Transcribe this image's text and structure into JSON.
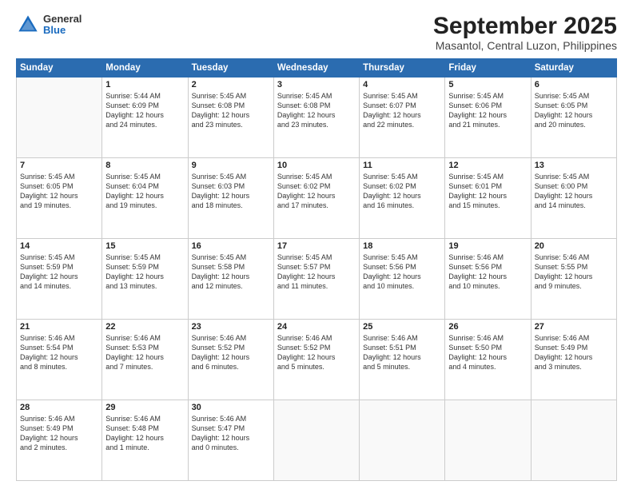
{
  "logo": {
    "general": "General",
    "blue": "Blue"
  },
  "title": "September 2025",
  "subtitle": "Masantol, Central Luzon, Philippines",
  "days_header": [
    "Sunday",
    "Monday",
    "Tuesday",
    "Wednesday",
    "Thursday",
    "Friday",
    "Saturday"
  ],
  "weeks": [
    [
      {
        "day": "",
        "info": ""
      },
      {
        "day": "1",
        "info": "Sunrise: 5:44 AM\nSunset: 6:09 PM\nDaylight: 12 hours\nand 24 minutes."
      },
      {
        "day": "2",
        "info": "Sunrise: 5:45 AM\nSunset: 6:08 PM\nDaylight: 12 hours\nand 23 minutes."
      },
      {
        "day": "3",
        "info": "Sunrise: 5:45 AM\nSunset: 6:08 PM\nDaylight: 12 hours\nand 23 minutes."
      },
      {
        "day": "4",
        "info": "Sunrise: 5:45 AM\nSunset: 6:07 PM\nDaylight: 12 hours\nand 22 minutes."
      },
      {
        "day": "5",
        "info": "Sunrise: 5:45 AM\nSunset: 6:06 PM\nDaylight: 12 hours\nand 21 minutes."
      },
      {
        "day": "6",
        "info": "Sunrise: 5:45 AM\nSunset: 6:05 PM\nDaylight: 12 hours\nand 20 minutes."
      }
    ],
    [
      {
        "day": "7",
        "info": "Sunrise: 5:45 AM\nSunset: 6:05 PM\nDaylight: 12 hours\nand 19 minutes."
      },
      {
        "day": "8",
        "info": "Sunrise: 5:45 AM\nSunset: 6:04 PM\nDaylight: 12 hours\nand 19 minutes."
      },
      {
        "day": "9",
        "info": "Sunrise: 5:45 AM\nSunset: 6:03 PM\nDaylight: 12 hours\nand 18 minutes."
      },
      {
        "day": "10",
        "info": "Sunrise: 5:45 AM\nSunset: 6:02 PM\nDaylight: 12 hours\nand 17 minutes."
      },
      {
        "day": "11",
        "info": "Sunrise: 5:45 AM\nSunset: 6:02 PM\nDaylight: 12 hours\nand 16 minutes."
      },
      {
        "day": "12",
        "info": "Sunrise: 5:45 AM\nSunset: 6:01 PM\nDaylight: 12 hours\nand 15 minutes."
      },
      {
        "day": "13",
        "info": "Sunrise: 5:45 AM\nSunset: 6:00 PM\nDaylight: 12 hours\nand 14 minutes."
      }
    ],
    [
      {
        "day": "14",
        "info": "Sunrise: 5:45 AM\nSunset: 5:59 PM\nDaylight: 12 hours\nand 14 minutes."
      },
      {
        "day": "15",
        "info": "Sunrise: 5:45 AM\nSunset: 5:59 PM\nDaylight: 12 hours\nand 13 minutes."
      },
      {
        "day": "16",
        "info": "Sunrise: 5:45 AM\nSunset: 5:58 PM\nDaylight: 12 hours\nand 12 minutes."
      },
      {
        "day": "17",
        "info": "Sunrise: 5:45 AM\nSunset: 5:57 PM\nDaylight: 12 hours\nand 11 minutes."
      },
      {
        "day": "18",
        "info": "Sunrise: 5:45 AM\nSunset: 5:56 PM\nDaylight: 12 hours\nand 10 minutes."
      },
      {
        "day": "19",
        "info": "Sunrise: 5:46 AM\nSunset: 5:56 PM\nDaylight: 12 hours\nand 10 minutes."
      },
      {
        "day": "20",
        "info": "Sunrise: 5:46 AM\nSunset: 5:55 PM\nDaylight: 12 hours\nand 9 minutes."
      }
    ],
    [
      {
        "day": "21",
        "info": "Sunrise: 5:46 AM\nSunset: 5:54 PM\nDaylight: 12 hours\nand 8 minutes."
      },
      {
        "day": "22",
        "info": "Sunrise: 5:46 AM\nSunset: 5:53 PM\nDaylight: 12 hours\nand 7 minutes."
      },
      {
        "day": "23",
        "info": "Sunrise: 5:46 AM\nSunset: 5:52 PM\nDaylight: 12 hours\nand 6 minutes."
      },
      {
        "day": "24",
        "info": "Sunrise: 5:46 AM\nSunset: 5:52 PM\nDaylight: 12 hours\nand 5 minutes."
      },
      {
        "day": "25",
        "info": "Sunrise: 5:46 AM\nSunset: 5:51 PM\nDaylight: 12 hours\nand 5 minutes."
      },
      {
        "day": "26",
        "info": "Sunrise: 5:46 AM\nSunset: 5:50 PM\nDaylight: 12 hours\nand 4 minutes."
      },
      {
        "day": "27",
        "info": "Sunrise: 5:46 AM\nSunset: 5:49 PM\nDaylight: 12 hours\nand 3 minutes."
      }
    ],
    [
      {
        "day": "28",
        "info": "Sunrise: 5:46 AM\nSunset: 5:49 PM\nDaylight: 12 hours\nand 2 minutes."
      },
      {
        "day": "29",
        "info": "Sunrise: 5:46 AM\nSunset: 5:48 PM\nDaylight: 12 hours\nand 1 minute."
      },
      {
        "day": "30",
        "info": "Sunrise: 5:46 AM\nSunset: 5:47 PM\nDaylight: 12 hours\nand 0 minutes."
      },
      {
        "day": "",
        "info": ""
      },
      {
        "day": "",
        "info": ""
      },
      {
        "day": "",
        "info": ""
      },
      {
        "day": "",
        "info": ""
      }
    ]
  ]
}
